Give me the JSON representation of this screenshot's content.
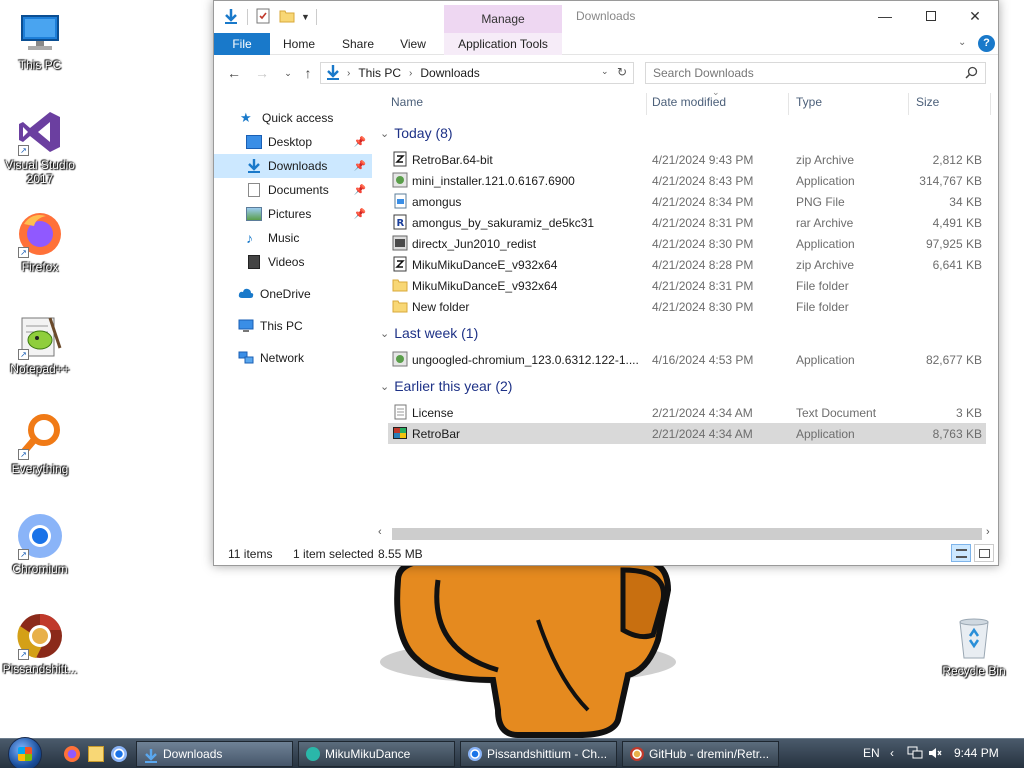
{
  "desktop": {
    "icons": [
      {
        "label": "This PC"
      },
      {
        "label": "Visual Studio 2017"
      },
      {
        "label": "Firefox"
      },
      {
        "label": "Notepad++"
      },
      {
        "label": "Everything"
      },
      {
        "label": "Chromium"
      },
      {
        "label": "Pissandshitt..."
      },
      {
        "label": "Recycle Bin"
      }
    ]
  },
  "window": {
    "title": "Downloads",
    "context_tab": "Manage",
    "ribbon_tabs": [
      "File",
      "Home",
      "Share",
      "View",
      "Application Tools"
    ],
    "help": "?",
    "address": {
      "segments": [
        "This PC",
        "Downloads"
      ]
    },
    "search_placeholder": "Search Downloads",
    "nav": {
      "quick_access": "Quick access",
      "items": [
        {
          "label": "Desktop"
        },
        {
          "label": "Downloads"
        },
        {
          "label": "Documents"
        },
        {
          "label": "Pictures"
        },
        {
          "label": "Music"
        },
        {
          "label": "Videos"
        }
      ],
      "onedrive": "OneDrive",
      "this_pc": "This PC",
      "network": "Network"
    },
    "columns": [
      "Name",
      "Date modified",
      "Type",
      "Size"
    ],
    "groups": [
      {
        "title": "Today (8)",
        "files": [
          {
            "name": "RetroBar.64-bit",
            "date": "4/21/2024 9:43 PM",
            "type": "zip Archive",
            "size": "2,812 KB"
          },
          {
            "name": "mini_installer.121.0.6167.6900",
            "date": "4/21/2024 8:43 PM",
            "type": "Application",
            "size": "314,767 KB"
          },
          {
            "name": "amongus",
            "date": "4/21/2024 8:34 PM",
            "type": "PNG File",
            "size": "34 KB"
          },
          {
            "name": "amongus_by_sakuramiz_de5kc31",
            "date": "4/21/2024 8:31 PM",
            "type": "rar Archive",
            "size": "4,491 KB"
          },
          {
            "name": "directx_Jun2010_redist",
            "date": "4/21/2024 8:30 PM",
            "type": "Application",
            "size": "97,925 KB"
          },
          {
            "name": "MikuMikuDanceE_v932x64",
            "date": "4/21/2024 8:28 PM",
            "type": "zip Archive",
            "size": "6,641 KB"
          },
          {
            "name": "MikuMikuDanceE_v932x64",
            "date": "4/21/2024 8:31 PM",
            "type": "File folder",
            "size": ""
          },
          {
            "name": "New folder",
            "date": "4/21/2024 8:30 PM",
            "type": "File folder",
            "size": ""
          }
        ]
      },
      {
        "title": "Last week (1)",
        "files": [
          {
            "name": "ungoogled-chromium_123.0.6312.122-1....",
            "date": "4/16/2024 4:53 PM",
            "type": "Application",
            "size": "82,677 KB"
          }
        ]
      },
      {
        "title": "Earlier this year (2)",
        "files": [
          {
            "name": "License",
            "date": "2/21/2024 4:34 AM",
            "type": "Text Document",
            "size": "3 KB"
          },
          {
            "name": "RetroBar",
            "date": "2/21/2024 4:34 AM",
            "type": "Application",
            "size": "8,763 KB"
          }
        ]
      }
    ],
    "status": {
      "items": "11 items",
      "selected": "1 item selected",
      "size": "8.55 MB"
    }
  },
  "taskbar": {
    "buttons": [
      {
        "label": "Downloads"
      },
      {
        "label": "MikuMikuDance"
      },
      {
        "label": "Pissandshittium - Ch..."
      },
      {
        "label": "GitHub - dremin/Retr..."
      }
    ],
    "lang": "EN",
    "time": "9:44 PM"
  }
}
